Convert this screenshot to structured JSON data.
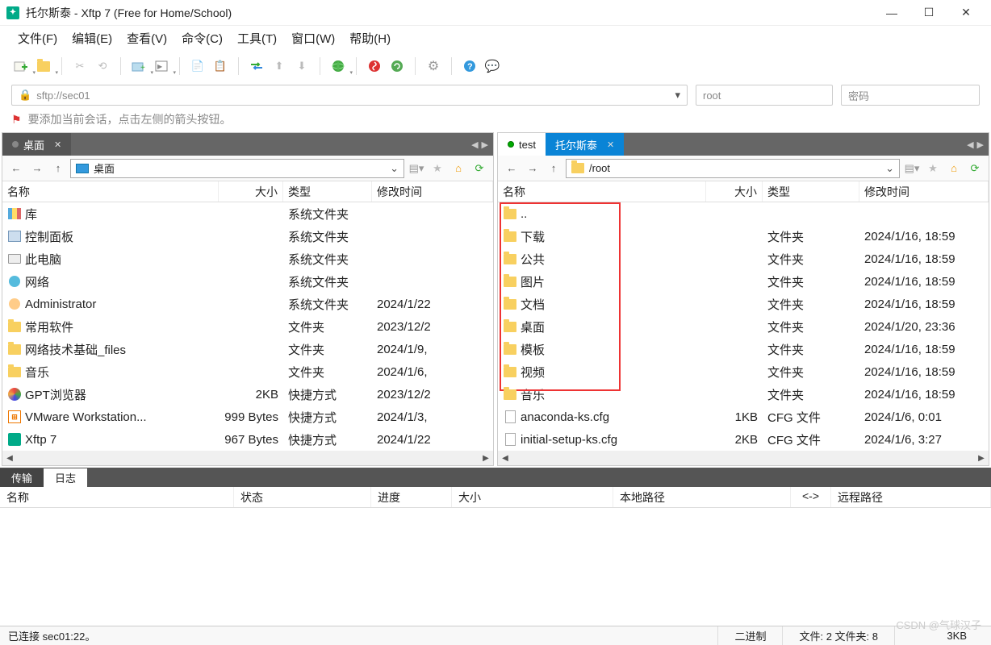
{
  "window": {
    "title": "托尔斯泰 - Xftp 7 (Free for Home/School)"
  },
  "menu": [
    "文件(F)",
    "编辑(E)",
    "查看(V)",
    "命令(C)",
    "工具(T)",
    "窗口(W)",
    "帮助(H)"
  ],
  "address": {
    "url": "sftp://sec01",
    "user": "root",
    "pass_placeholder": "密码"
  },
  "hint": "要添加当前会话，点击左侧的箭头按钮。",
  "left": {
    "tab": "桌面",
    "path": "桌面",
    "cols": {
      "name": "名称",
      "size": "大小",
      "type": "类型",
      "date": "修改时间"
    },
    "rows": [
      {
        "icon": "lib",
        "name": "库",
        "size": "",
        "type": "系统文件夹",
        "date": ""
      },
      {
        "icon": "cp",
        "name": "控制面板",
        "size": "",
        "type": "系统文件夹",
        "date": ""
      },
      {
        "icon": "pc",
        "name": "此电脑",
        "size": "",
        "type": "系统文件夹",
        "date": ""
      },
      {
        "icon": "net",
        "name": "网络",
        "size": "",
        "type": "系统文件夹",
        "date": ""
      },
      {
        "icon": "user",
        "name": "Administrator",
        "size": "",
        "type": "系统文件夹",
        "date": "2024/1/22"
      },
      {
        "icon": "folder",
        "name": "常用软件",
        "size": "",
        "type": "文件夹",
        "date": "2023/12/2"
      },
      {
        "icon": "folder",
        "name": "网络技术基础_files",
        "size": "",
        "type": "文件夹",
        "date": "2024/1/9,"
      },
      {
        "icon": "folder",
        "name": "音乐",
        "size": "",
        "type": "文件夹",
        "date": "2024/1/6,"
      },
      {
        "icon": "gpt",
        "name": "GPT浏览器",
        "size": "2KB",
        "type": "快捷方式",
        "date": "2023/12/2"
      },
      {
        "icon": "vm",
        "name": "VMware Workstation...",
        "size": "999 Bytes",
        "type": "快捷方式",
        "date": "2024/1/3,"
      },
      {
        "icon": "xftp",
        "name": "Xftp 7",
        "size": "967 Bytes",
        "type": "快捷方式",
        "date": "2024/1/22"
      }
    ]
  },
  "right": {
    "tabs": [
      {
        "label": "test",
        "active": true,
        "close": false
      },
      {
        "label": "托尔斯泰",
        "active": false,
        "blue": true,
        "close": true
      }
    ],
    "path": "/root",
    "cols": {
      "name": "名称",
      "size": "大小",
      "type": "类型",
      "date": "修改时间"
    },
    "rows": [
      {
        "icon": "folder",
        "name": "..",
        "size": "",
        "type": "",
        "date": ""
      },
      {
        "icon": "folder",
        "name": "下载",
        "size": "",
        "type": "文件夹",
        "date": "2024/1/16, 18:59"
      },
      {
        "icon": "folder",
        "name": "公共",
        "size": "",
        "type": "文件夹",
        "date": "2024/1/16, 18:59"
      },
      {
        "icon": "folder",
        "name": "图片",
        "size": "",
        "type": "文件夹",
        "date": "2024/1/16, 18:59"
      },
      {
        "icon": "folder",
        "name": "文档",
        "size": "",
        "type": "文件夹",
        "date": "2024/1/16, 18:59"
      },
      {
        "icon": "folder",
        "name": "桌面",
        "size": "",
        "type": "文件夹",
        "date": "2024/1/20, 23:36"
      },
      {
        "icon": "folder",
        "name": "模板",
        "size": "",
        "type": "文件夹",
        "date": "2024/1/16, 18:59"
      },
      {
        "icon": "folder",
        "name": "视频",
        "size": "",
        "type": "文件夹",
        "date": "2024/1/16, 18:59"
      },
      {
        "icon": "folder",
        "name": "音乐",
        "size": "",
        "type": "文件夹",
        "date": "2024/1/16, 18:59"
      },
      {
        "icon": "file",
        "name": "anaconda-ks.cfg",
        "size": "1KB",
        "type": "CFG 文件",
        "date": "2024/1/6, 0:01"
      },
      {
        "icon": "file",
        "name": "initial-setup-ks.cfg",
        "size": "2KB",
        "type": "CFG 文件",
        "date": "2024/1/6, 3:27"
      }
    ]
  },
  "bottom": {
    "tabs": [
      "传输",
      "日志"
    ],
    "cols": [
      "名称",
      "状态",
      "进度",
      "大小",
      "本地路径",
      "<->",
      "远程路径"
    ]
  },
  "status": {
    "conn": "已连接 sec01:22。",
    "enc": "二进制",
    "count": "文件: 2 文件夹: 8",
    "size": "3KB"
  },
  "watermark": "CSDN @气球汉子"
}
